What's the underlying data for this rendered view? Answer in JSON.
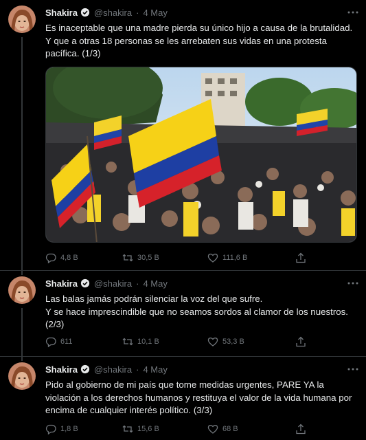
{
  "tweets": [
    {
      "name": "Shakira",
      "handle": "@shakira",
      "date": "4 May",
      "text": "Es inaceptable que una madre pierda su único hijo a causa de la brutalidad.\nY que a otras 18 personas se les arrebaten sus vidas en una protesta\npacífica. (1/3)",
      "replies": "4,8 B",
      "retweets": "30,5 B",
      "likes": "111,6 B"
    },
    {
      "name": "Shakira",
      "handle": "@shakira",
      "date": "4 May",
      "text": "Las balas jamás podrán silenciar la voz del que sufre.\nY se hace imprescindible que no seamos sordos al clamor de los nuestros.\n(2/3)",
      "replies": "611",
      "retweets": "10,1 B",
      "likes": "53,3 B"
    },
    {
      "name": "Shakira",
      "handle": "@shakira",
      "date": "4 May",
      "text": "Pido al gobierno de mi país que tome medidas urgentes, PARE YA la\nviolación a los derechos humanos y restituya el valor de la vida humana por\nencima de cualquier interés político. (3/3)",
      "replies": "1,8 B",
      "retweets": "15,6 B",
      "likes": "68 B"
    }
  ],
  "icons": {
    "verified": "verified-badge-icon",
    "more": "more-dots-icon",
    "reply": "reply-icon",
    "retweet": "retweet-icon",
    "like": "heart-icon",
    "share": "share-icon"
  },
  "colors": {
    "background": "#000000",
    "text": "#e7e9ea",
    "muted": "#71767b",
    "verified": "#1d9bf0"
  }
}
